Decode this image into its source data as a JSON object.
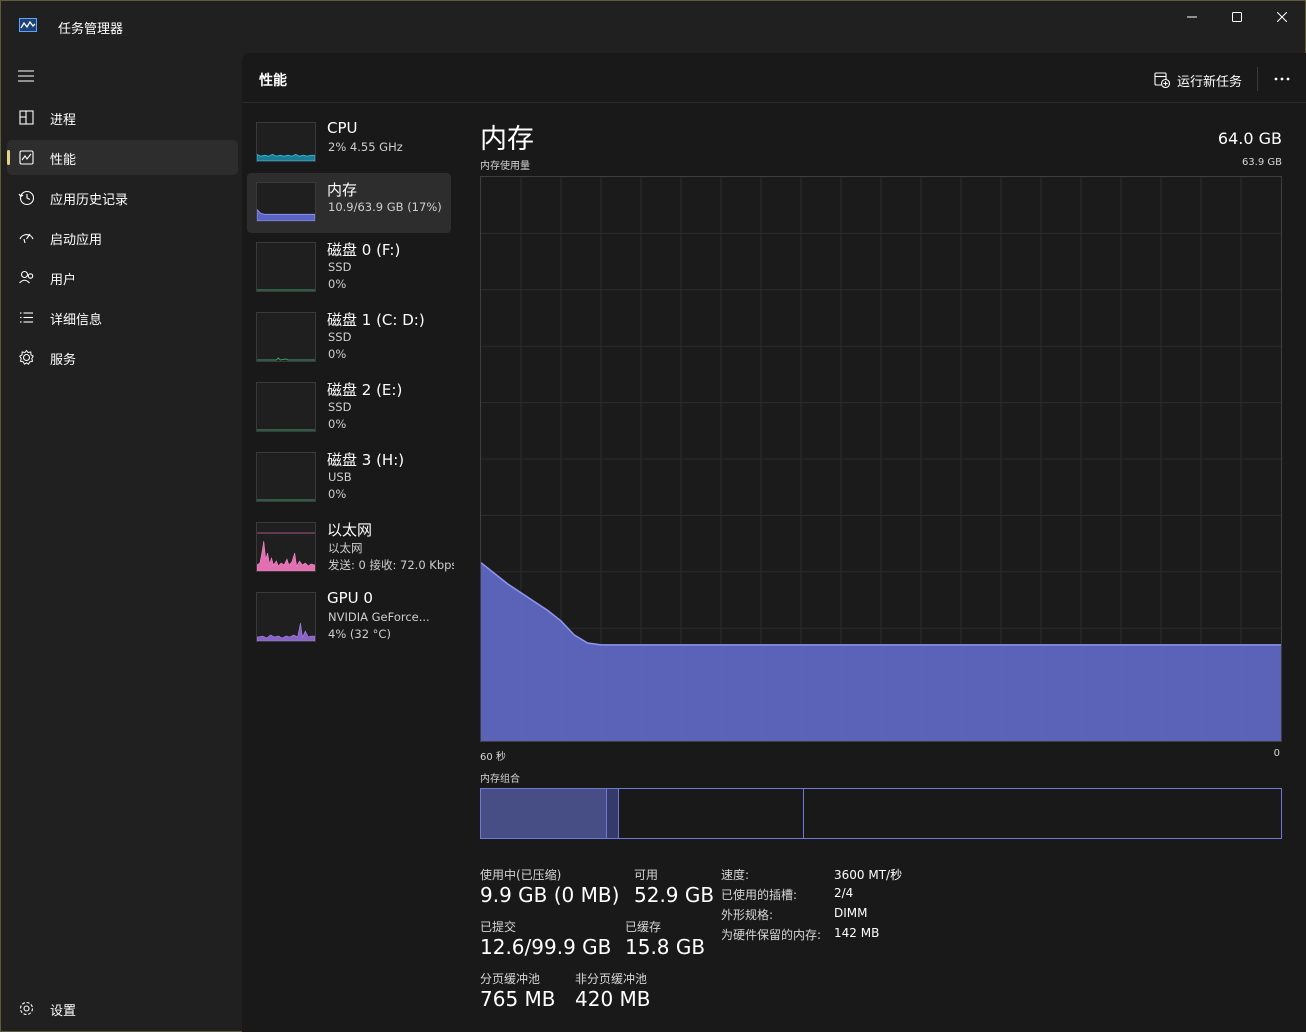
{
  "window": {
    "title": "任务管理器"
  },
  "nav": {
    "items": [
      {
        "label": "进程",
        "icon": "processes-icon"
      },
      {
        "label": "性能",
        "icon": "performance-icon",
        "active": true
      },
      {
        "label": "应用历史记录",
        "icon": "app-history-icon"
      },
      {
        "label": "启动应用",
        "icon": "startup-apps-icon"
      },
      {
        "label": "用户",
        "icon": "users-icon"
      },
      {
        "label": "详细信息",
        "icon": "details-icon"
      },
      {
        "label": "服务",
        "icon": "services-icon"
      }
    ],
    "settings_label": "设置"
  },
  "header": {
    "title": "性能",
    "run_task_label": "运行新任务"
  },
  "devices": [
    {
      "name": "CPU",
      "sub1": "2% 4.55 GHz",
      "sub2": ""
    },
    {
      "name": "内存",
      "sub1": "10.9/63.9 GB (17%)",
      "sub2": ""
    },
    {
      "name": "磁盘 0 (F:)",
      "sub1": "SSD",
      "sub2": "0%"
    },
    {
      "name": "磁盘 1 (C: D:)",
      "sub1": "SSD",
      "sub2": "0%"
    },
    {
      "name": "磁盘 2 (E:)",
      "sub1": "SSD",
      "sub2": "0%"
    },
    {
      "name": "磁盘 3 (H:)",
      "sub1": "USB",
      "sub2": "0%"
    },
    {
      "name": "以太网",
      "sub1": "以太网",
      "sub2": "发送: 0 接收: 72.0 Kbps"
    },
    {
      "name": "GPU 0",
      "sub1": "NVIDIA GeForce...",
      "sub2": "4% (32 °C)"
    }
  ],
  "detail": {
    "title": "内存",
    "total": "64.0 GB",
    "usage_label": "内存使用量",
    "usage_max": "63.9 GB",
    "time_left": "60 秒",
    "time_right": "0",
    "composition_label": "内存组合",
    "stats": {
      "in_use_label": "使用中(已压缩)",
      "in_use": "9.9 GB (0 MB)",
      "available_label": "可用",
      "available": "52.9 GB",
      "committed_label": "已提交",
      "committed": "12.6/99.9 GB",
      "cached_label": "已缓存",
      "cached": "15.8 GB",
      "paged_label": "分页缓冲池",
      "paged": "765 MB",
      "nonpaged_label": "非分页缓冲池",
      "nonpaged": "420 MB"
    },
    "properties": [
      {
        "label": "速度:",
        "value": "3600 MT/秒"
      },
      {
        "label": "已使用的插槽:",
        "value": "2/4"
      },
      {
        "label": "外形规格:",
        "value": "DIMM"
      },
      {
        "label": "为硬件保留的内存:",
        "value": "142 MB"
      }
    ]
  },
  "chart_data": {
    "type": "area",
    "title": "",
    "xlabel": "",
    "ylabel": "",
    "x_range": [
      60,
      0
    ],
    "ylim": [
      0,
      63.9
    ],
    "series": [
      {
        "color": "#6f77d9",
        "values": [
          20.2,
          19.0,
          17.8,
          16.8,
          15.8,
          14.8,
          13.6,
          12.0,
          11.1,
          10.9,
          10.9,
          10.9,
          10.9,
          10.9,
          10.9,
          10.9,
          10.9,
          10.9,
          10.9,
          10.9,
          10.9,
          10.9,
          10.9,
          10.9,
          10.9,
          10.9,
          10.9,
          10.9,
          10.9,
          10.9,
          10.9,
          10.9,
          10.9,
          10.9,
          10.9,
          10.9,
          10.9,
          10.9,
          10.9,
          10.9,
          10.9,
          10.9,
          10.9,
          10.9,
          10.9,
          10.9,
          10.9,
          10.9,
          10.9,
          10.9,
          10.9,
          10.9,
          10.9,
          10.9,
          10.9,
          10.9,
          10.9,
          10.9,
          10.9,
          10.9,
          10.9
        ]
      }
    ],
    "composition": [
      {
        "segment": "in-use",
        "fraction": 0.157
      },
      {
        "segment": "modified",
        "fraction": 0.015
      },
      {
        "segment": "standby",
        "fraction": 0.232
      },
      {
        "segment": "free",
        "fraction": 0.596
      }
    ]
  }
}
